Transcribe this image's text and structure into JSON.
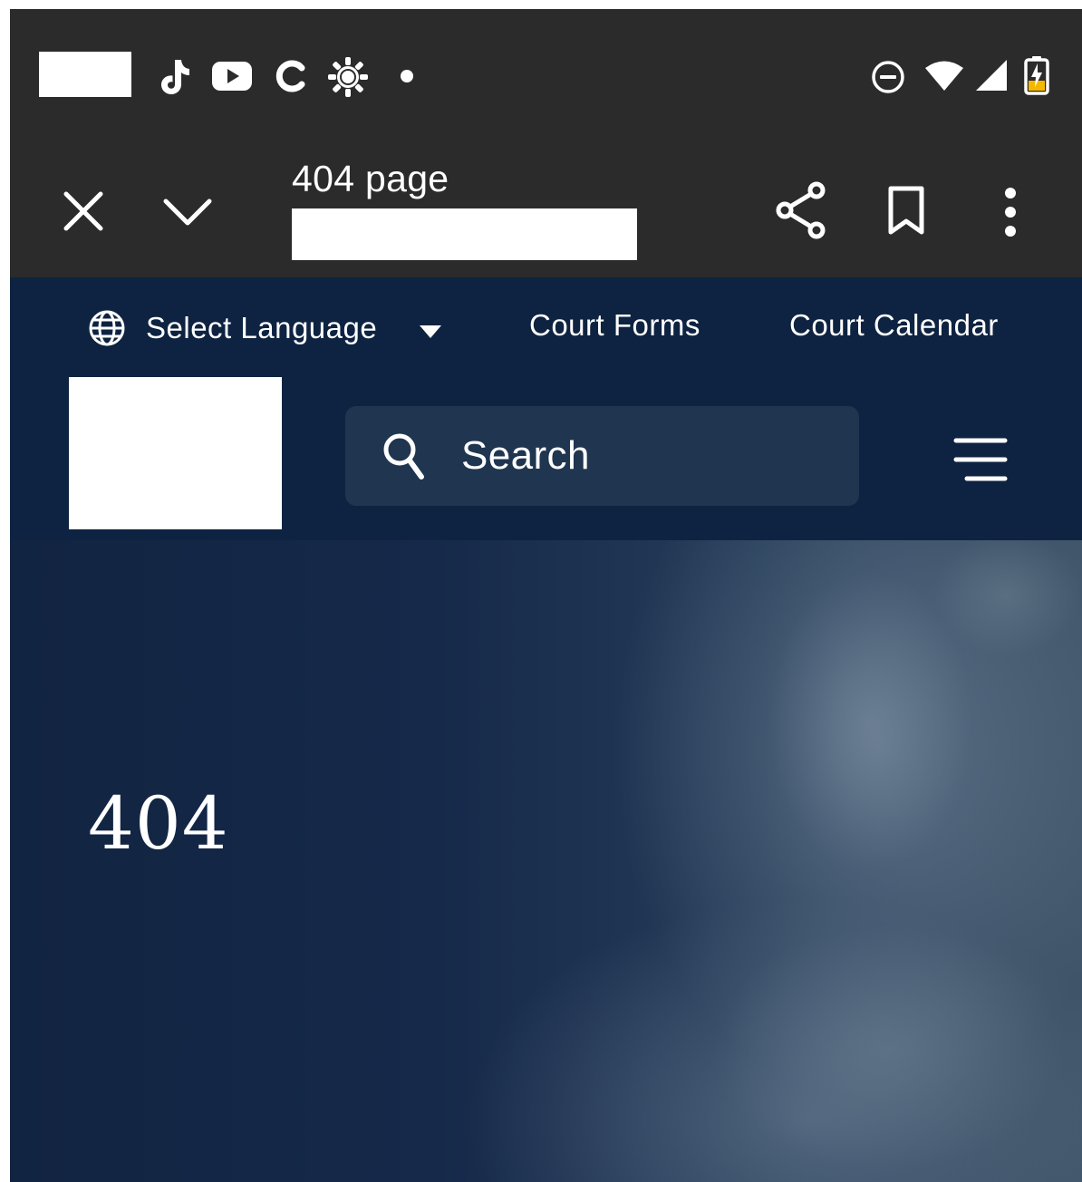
{
  "status_bar": {
    "icons": [
      "tiktok-icon",
      "youtube-icon",
      "c-app-icon",
      "brightness-icon",
      "notification-dot-icon",
      "dnd-icon",
      "wifi-icon",
      "signal-icon",
      "battery-charging-icon"
    ]
  },
  "toolbar": {
    "title": "404 page",
    "icons": [
      "close-icon",
      "chevron-down-icon",
      "share-icon",
      "bookmark-icon",
      "more-vert-icon"
    ]
  },
  "header": {
    "language_label": "Select Language",
    "links": [
      "Court Forms",
      "Court Calendar"
    ],
    "search_placeholder": "Search",
    "icons": [
      "globe-icon",
      "caret-down-icon",
      "search-icon",
      "menu-icon"
    ]
  },
  "hero": {
    "heading": "404"
  },
  "colors": {
    "status_bar_bg": "#2b2b2b",
    "header_bg": "#0e2341",
    "search_bg": "#1f3550",
    "text": "#ffffff",
    "battery_accent": "#f5b800"
  }
}
